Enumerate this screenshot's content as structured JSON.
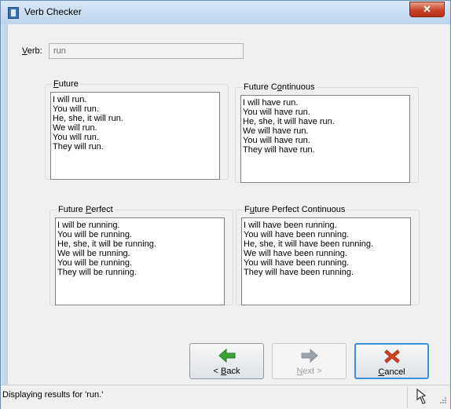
{
  "window": {
    "title": "Verb Checker",
    "close_glyph": "✕"
  },
  "verb": {
    "label_prefix": "",
    "label_accel": "V",
    "label_rest": "erb:",
    "value": "run"
  },
  "groups": {
    "future": {
      "accel": "F",
      "rest": "uture",
      "pre": "",
      "lines": "I will run.\nYou will run.\nHe, she, it will run.\nWe will run.\nYou will run.\nThey will run."
    },
    "future_continuous": {
      "pre": "Future C",
      "accel": "o",
      "rest": "ntinuous",
      "lines": "I will have run.\nYou will have run.\nHe, she, it will have run.\nWe will have run.\nYou will have run.\nThey will have run."
    },
    "future_perfect": {
      "pre": "Future ",
      "accel": "P",
      "rest": "erfect",
      "lines": "I will be running.\nYou will be running.\nHe, she, it will be running.\nWe will be running.\nYou will be running.\nThey will be running."
    },
    "future_perfect_continuous": {
      "pre": "F",
      "accel": "u",
      "rest": "ture Perfect Continuous",
      "lines": "I will have been running.\nYou will have been running.\nHe, she, it will have been running.\nWe will have been running.\nYou will have been running.\nThey will have been running."
    }
  },
  "buttons": {
    "back": {
      "pre": "< ",
      "accel": "B",
      "rest": "ack",
      "icon": "arrow-left-icon",
      "color": "#3aa335"
    },
    "next": {
      "pre": "",
      "accel": "N",
      "rest": "ext >",
      "icon": "arrow-right-icon",
      "color": "#9aa3ab"
    },
    "cancel": {
      "pre": "",
      "accel": "C",
      "rest": "ancel",
      "icon": "x-mark-icon",
      "color": "#d9421f"
    }
  },
  "status": {
    "text": "Displaying results for 'run.'"
  }
}
